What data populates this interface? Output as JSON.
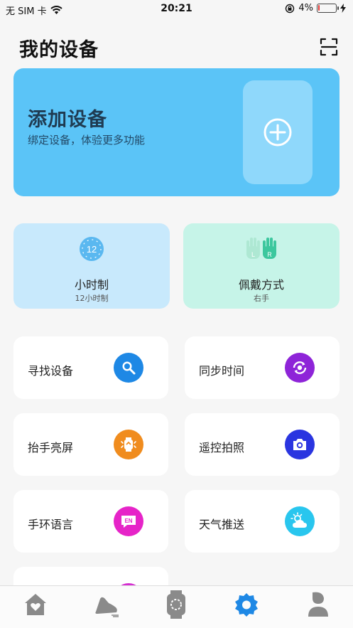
{
  "status_bar": {
    "carrier": "无 SIM 卡",
    "time": "20:21",
    "battery_pct": "4%",
    "battery_level": 0.04
  },
  "header": {
    "title": "我的设备"
  },
  "add_device": {
    "title": "添加设备",
    "subtitle": "绑定设备，体验更多功能"
  },
  "info_cards": [
    {
      "label": "小时制",
      "value": "12小时制",
      "icon": "clock-12-icon",
      "icon_text": "12"
    },
    {
      "label": "佩戴方式",
      "value": "右手",
      "icon": "hands-lr-icon",
      "icon_left": "L",
      "icon_right": "R"
    }
  ],
  "tiles": [
    {
      "label": "寻找设备",
      "icon": "search-device-icon",
      "color": "#1e88e5"
    },
    {
      "label": "同步时间",
      "icon": "sync-time-icon",
      "color": "#8e24d8"
    },
    {
      "label": "抬手亮屏",
      "icon": "raise-wrist-icon",
      "color": "#f08c1e"
    },
    {
      "label": "遥控拍照",
      "icon": "camera-icon",
      "color": "#2a35e0"
    },
    {
      "label": "手环语言",
      "icon": "language-icon",
      "color": "#e624c8",
      "badge": "EN"
    },
    {
      "label": "天气推送",
      "icon": "weather-icon",
      "color": "#29c6ee"
    },
    {
      "label": "",
      "icon": "more-icon",
      "color": "#d42bd0"
    }
  ],
  "nav": [
    {
      "name": "home",
      "icon": "home-icon",
      "active": false
    },
    {
      "name": "sport",
      "icon": "sport-shoe-icon",
      "active": false
    },
    {
      "name": "watch",
      "icon": "watch-face-icon",
      "active": false
    },
    {
      "name": "device",
      "icon": "gear-icon",
      "active": true,
      "color": "#1e88e5"
    },
    {
      "name": "profile",
      "icon": "person-icon",
      "active": false
    }
  ]
}
